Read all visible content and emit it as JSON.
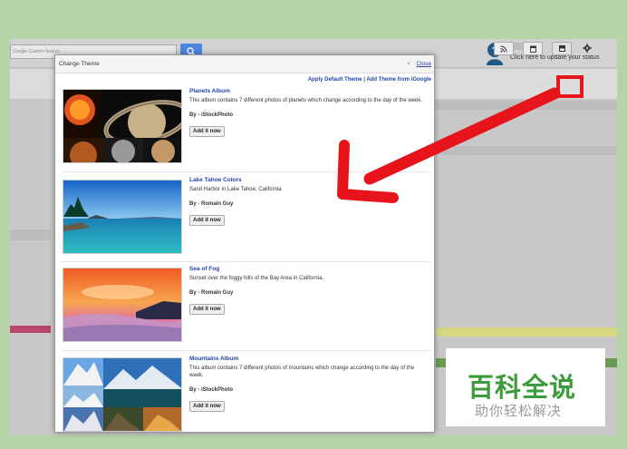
{
  "search": {
    "placeholder": "Google Custom Search"
  },
  "status": {
    "text": "Click here to update your status"
  },
  "modal": {
    "title": "Change Theme",
    "close_label": "Close",
    "close_x": "×",
    "apply_default": "Apply Default Theme",
    "separator": "|",
    "add_from": "Add Theme from iGoogle"
  },
  "themes": [
    {
      "name": "Planets Album",
      "description": "This album contains 7 different photos of planets which change according to the day of the week.",
      "by_label": "By -",
      "author": "iStockPhoto",
      "button": "Add it now"
    },
    {
      "name": "Lake Tahoe Colors",
      "description": "Sand Harbor in Lake Tahoe, California",
      "by_label": "By -",
      "author": "Romain Guy",
      "button": "Add it now"
    },
    {
      "name": "Sea of Fog",
      "description": "Sunset over the foggy hills of the Bay Area in California.",
      "by_label": "By -",
      "author": "Romain Guy",
      "button": "Add it now"
    },
    {
      "name": "Mountains Album",
      "description": "This album contains 7 different photos of mountains which change according to the day of the week.",
      "by_label": "By -",
      "author": "iStockPhoto",
      "button": "Add it now"
    }
  ],
  "toolbar_icons": {
    "rss": "rss-icon",
    "calendar": "calendar-icon",
    "theme": "theme-icon",
    "gear": "gear-icon"
  },
  "watermark": {
    "title": "百科全说",
    "subtitle": "助你轻松解决"
  },
  "colors": {
    "highlight": "#e8141b",
    "link": "#2246a8",
    "watermark_green": "#3c9b3c"
  }
}
